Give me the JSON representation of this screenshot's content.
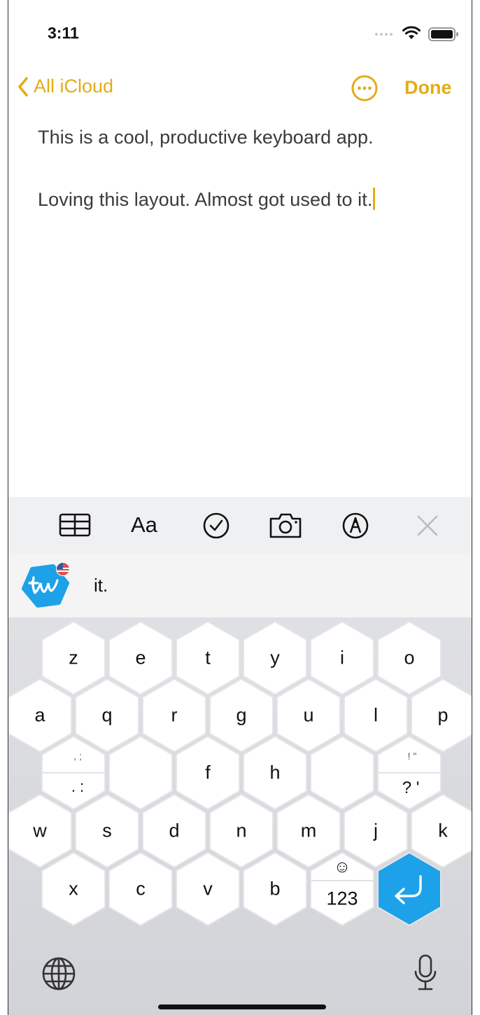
{
  "status_bar": {
    "time": "3:11"
  },
  "nav": {
    "back_label": "All iCloud",
    "done_label": "Done"
  },
  "note": {
    "line1": "This is a cool, productive keyboard app.",
    "line2": "Loving this layout. Almost got used to it."
  },
  "toolbar": {
    "items": [
      "table-icon",
      "format-text",
      "checklist-icon",
      "camera-icon",
      "markup-icon",
      "close-icon"
    ],
    "format_label": "Aa"
  },
  "suggestion": {
    "word": "it."
  },
  "keyboard": {
    "rows": [
      [
        "z",
        "e",
        "t",
        "y",
        "i",
        "o"
      ],
      [
        "a",
        "q",
        "r",
        "g",
        "u",
        "l",
        "p"
      ],
      [
        "f",
        "h"
      ],
      [
        "w",
        "s",
        "d",
        "n",
        "m",
        "j",
        "k"
      ],
      [
        "x",
        "c",
        "v",
        "b"
      ]
    ],
    "punct_left_top": ", ;",
    "punct_left_bottom": ". :",
    "punct_right_top": "! \"",
    "punct_right_bottom": "? '",
    "numbers_label": "123",
    "emoji_symbol": "☺",
    "return_icon": "return-icon",
    "accent_color": "#1da1e8"
  },
  "colors": {
    "accent": "#e2ad15",
    "key": "#ffffff",
    "keyboard_bg": "#d9dade"
  }
}
